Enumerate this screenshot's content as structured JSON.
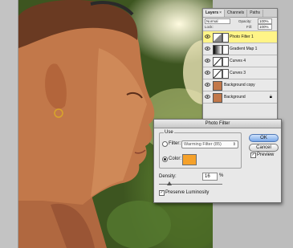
{
  "layers_panel": {
    "tabs": [
      {
        "label": "Layers",
        "active": true
      },
      {
        "label": "Channels",
        "active": false
      },
      {
        "label": "Paths",
        "active": false
      }
    ],
    "blend_mode": "Normal",
    "opacity_label": "Opacity:",
    "opacity_value": "100%",
    "lock_label": "Lock:",
    "fill_label": "Fill:",
    "fill_value": "100%",
    "layers": [
      {
        "name": "Photo Filter 1",
        "selected": true,
        "visible": true
      },
      {
        "name": "Gradient Map 1",
        "selected": false,
        "visible": true
      },
      {
        "name": "Curves 4",
        "selected": false,
        "visible": true
      },
      {
        "name": "Curves 3",
        "selected": false,
        "visible": true
      },
      {
        "name": "Background copy",
        "selected": false,
        "visible": true
      },
      {
        "name": "Background",
        "selected": false,
        "visible": true,
        "locked": true
      }
    ]
  },
  "dialog": {
    "title": "Photo Filter",
    "use_label": "Use",
    "filter_label": "Filter:",
    "filter_value": "Warming Filter (85)",
    "color_label": "Color:",
    "color_value": "#f5a12a",
    "selected_option": "color",
    "density_label": "Density:",
    "density_value": "16",
    "density_unit": "%",
    "density_fraction": 0.16,
    "preserve_label": "Preserve Luminosity",
    "preserve_checked": true,
    "ok_label": "OK",
    "cancel_label": "Cancel",
    "preview_label": "Preview",
    "preview_checked": true
  }
}
